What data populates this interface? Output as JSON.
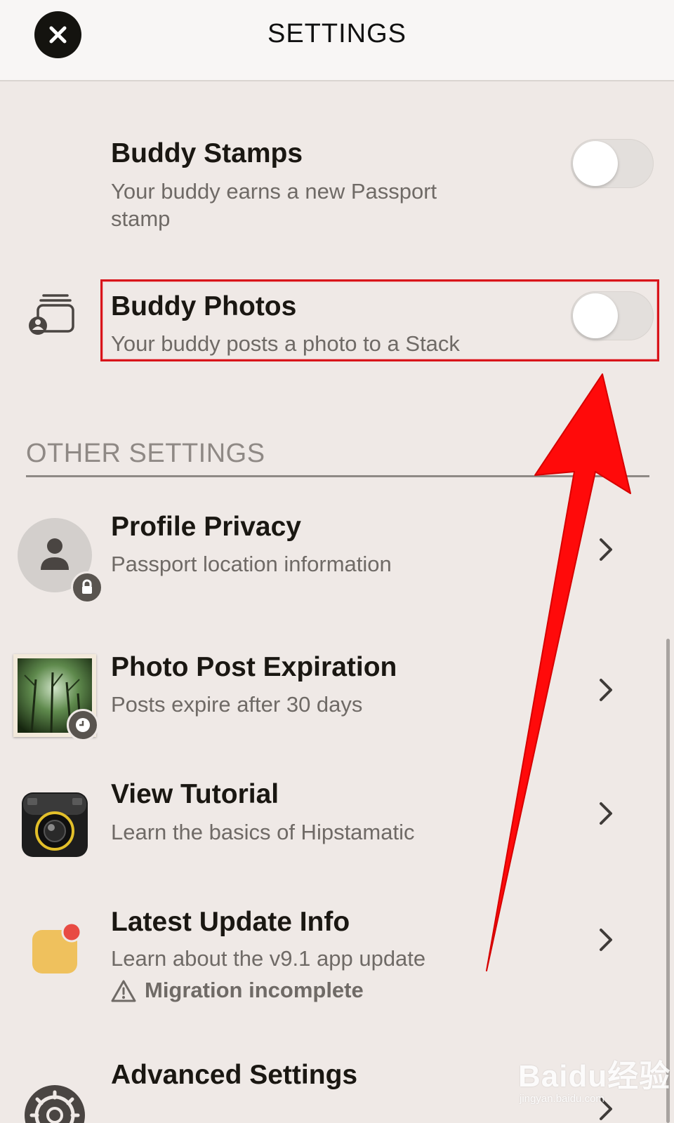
{
  "header": {
    "title": "SETTINGS"
  },
  "notifications": {
    "buddy_stamps": {
      "title": "Buddy Stamps",
      "subtitle": "Your buddy earns a new Passport stamp",
      "enabled": false
    },
    "buddy_photos": {
      "title": "Buddy Photos",
      "subtitle": "Your buddy posts a photo to a Stack",
      "enabled": false
    }
  },
  "other_settings": {
    "section_label": "OTHER SETTINGS",
    "items": [
      {
        "title": "Profile Privacy",
        "subtitle": "Passport location information",
        "icon": "profile-lock-icon"
      },
      {
        "title": "Photo Post Expiration",
        "subtitle": "Posts expire after 30 days",
        "icon": "forest-photo-clock-icon"
      },
      {
        "title": "View Tutorial",
        "subtitle": "Learn the basics of Hipstamatic",
        "icon": "camera-icon"
      },
      {
        "title": "Latest Update Info",
        "subtitle": "Learn about the v9.1 app update",
        "warning": "Migration incomplete",
        "icon": "update-badge-icon"
      },
      {
        "title": "Advanced Settings",
        "icon": "gear-icon"
      }
    ]
  },
  "annotation": {
    "highlight_color": "#d8141a",
    "arrow_color": "#ff0a0a"
  },
  "watermark": {
    "text": "Baidu经验",
    "sub": "jingyan.baidu.com"
  }
}
